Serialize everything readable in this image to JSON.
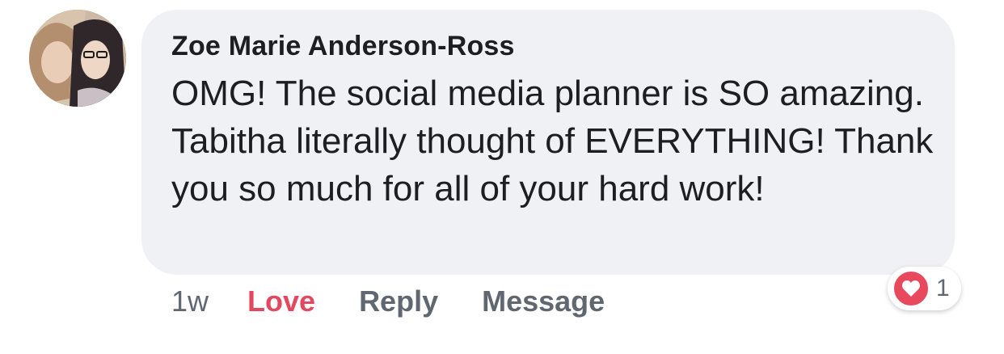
{
  "comment": {
    "author": "Zoe Marie Anderson-Ross",
    "text": "OMG! The social media planner is SO amazing. Tabitha literally thought of EVERYTHING! Thank you so much for all of your hard work!",
    "timestamp": "1w",
    "actions": {
      "love": "Love",
      "reply": "Reply",
      "message": "Message"
    },
    "reaction": {
      "icon": "heart-icon",
      "count": "1",
      "color": "#e8495d"
    }
  },
  "colors": {
    "bubble_bg": "#f0f1f4",
    "text": "#1c1e21",
    "secondary": "#606770",
    "love_accent": "#e34860"
  }
}
